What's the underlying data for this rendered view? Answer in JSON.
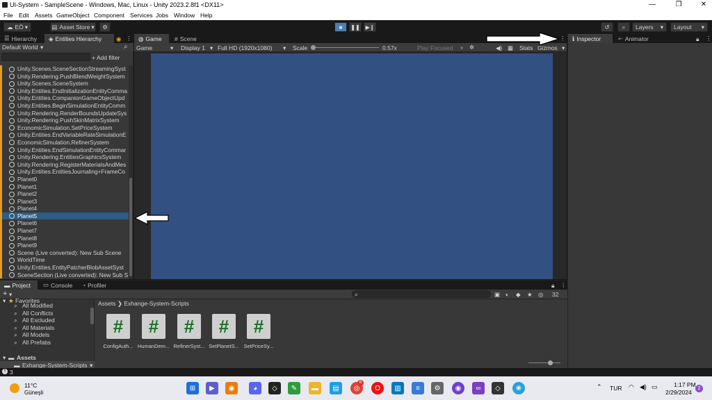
{
  "window": {
    "title": "UI-System - SampleScene - Windows, Mac, Linux - Unity 2023.2.8f1 <DX11>"
  },
  "menu": [
    "File",
    "Edit",
    "Assets",
    "GameObject",
    "Component",
    "Services",
    "Jobs",
    "Window",
    "Help"
  ],
  "toolbar": {
    "account": "EÖ",
    "asset_store": "Asset Store",
    "layers": "Layers",
    "layout": "Layout"
  },
  "hierarchy": {
    "tabs": [
      "Hierarchy",
      "Entities Hierarchy"
    ],
    "world": "Default World",
    "add_filter": "+ Add filter",
    "items": [
      "Unity.Scenes.SceneSectionStreamingSyst",
      "Unity.Rendering.PushBlendWeightSystem",
      "Unity.Scenes.SceneSystem",
      "Unity.Entities.EndInitializationEntityComma",
      "Unity.Entities.CompanionGameObjectUpd",
      "Unity.Entities.BeginSimulationEntityComm",
      "Unity.Rendering.RenderBoundsUpdateSys",
      "Unity.Rendering.PushSkinMatrixSystem",
      "EconomicSimulation.SetPriceSystem",
      "Unity.Entities.EndVariableRateSimulationE",
      "EconomicSimulation.RefinerSystem",
      "Unity.Entities.EndSimulationEntityCommar",
      "Unity.Rendering.EntitiesGraphicsSystem",
      "Unity.Rendering.RegisterMaterialsAndMes",
      "Unity.Entities.EntitiesJournaling+FrameCo",
      "Planet0",
      "Planet1",
      "Planet2",
      "Planet3",
      "Planet4",
      "Planet5",
      "Planet6",
      "Planet7",
      "Planet8",
      "Planet9",
      "Scene (Live converted): New Sub Scene",
      "WorldTime",
      "Unity.Entities.EntityPatcherBlobAssetSyst",
      "SceneSection (Live converted): New Sub S"
    ],
    "selected_index": 20
  },
  "game": {
    "tabs": [
      "Game",
      "Scene"
    ],
    "display_mode": "Game",
    "display": "Display 1",
    "resolution": "Full HD (1920x1080)",
    "scale_label": "Scale",
    "scale_value": "0.57x",
    "play_focused": "Play Focused",
    "stats": "Stats",
    "gizmos": "Gizmos"
  },
  "inspector": {
    "tabs": [
      "Inspector",
      "Animator"
    ]
  },
  "project": {
    "tabs": [
      "Project",
      "Console",
      "Profiler"
    ],
    "favorites_label": "Favorites",
    "favorites": [
      "All Modified",
      "All Conflicts",
      "All Excluded",
      "All Materials",
      "All Models",
      "All Prefabs"
    ],
    "assets_label": "Assets",
    "folder": "Exhange-System-Scripts",
    "breadcrumb": [
      "Assets",
      "Exhange-System-Scripts"
    ],
    "count": "32",
    "files": [
      "ConfigAuth...",
      "HumanDem...",
      "RefinerSyst...",
      "SetPlanetS...",
      "SetPriceSy..."
    ]
  },
  "status": {
    "count": "3"
  },
  "taskbar": {
    "weather_temp": "11°C",
    "weather_desc": "Güneşli",
    "lang": "TUR",
    "time": "1:17 PM",
    "date": "2/29/2024",
    "notif": "2",
    "chrome_badge": "6"
  },
  "colors": {
    "accent": "#2c5d87",
    "game_bg": "#335083",
    "panel": "#383838",
    "dark": "#191919"
  }
}
